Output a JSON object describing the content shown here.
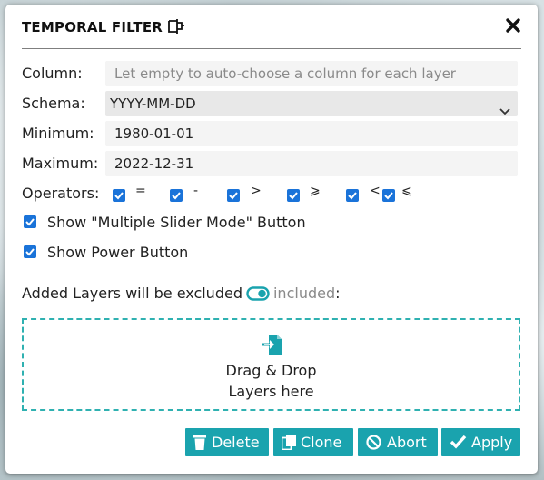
{
  "dialog": {
    "title": "TEMPORAL FILTER",
    "title_icon": "column-split-icon",
    "close_icon": "close-x-icon"
  },
  "form": {
    "column": {
      "label": "Column:",
      "placeholder": "Let empty to auto-choose a column for each layer",
      "value": ""
    },
    "schema": {
      "label": "Schema:",
      "value": "YYYY-MM-DD"
    },
    "minimum": {
      "label": "Minimum:",
      "value": "1980-01-01"
    },
    "maximum": {
      "label": "Maximum:",
      "value": "2022-12-31"
    },
    "operators": {
      "label": "Operators:",
      "items": [
        {
          "symbol": "=",
          "checked": true
        },
        {
          "symbol": "-",
          "checked": true
        },
        {
          "symbol": ">",
          "checked": true
        },
        {
          "symbol": "⩾",
          "checked": true
        },
        {
          "symbol": "<",
          "checked": true
        },
        {
          "symbol": "⩽",
          "checked": true
        }
      ]
    },
    "show_multi_slider": {
      "label": "Show \"Multiple Slider Mode\" Button",
      "checked": true
    },
    "show_power": {
      "label": "Show Power Button",
      "checked": true
    }
  },
  "layers_note": {
    "prefix": "Added Layers will be excluded",
    "toggle_icon": "toggle-icon",
    "included": "included",
    "suffix": ":"
  },
  "dropzone": {
    "icon": "file-import-icon",
    "line1": "Drag & Drop",
    "line2": "Layers here"
  },
  "buttons": {
    "delete": {
      "label": "Delete",
      "icon": "trash-icon"
    },
    "clone": {
      "label": "Clone",
      "icon": "copy-icon"
    },
    "abort": {
      "label": "Abort",
      "icon": "ban-icon"
    },
    "apply": {
      "label": "Apply",
      "icon": "check-icon"
    }
  },
  "colors": {
    "accent": "#1aa3ae",
    "checkbox": "#1a73d9",
    "dropzone_border": "#2fb1b1"
  }
}
